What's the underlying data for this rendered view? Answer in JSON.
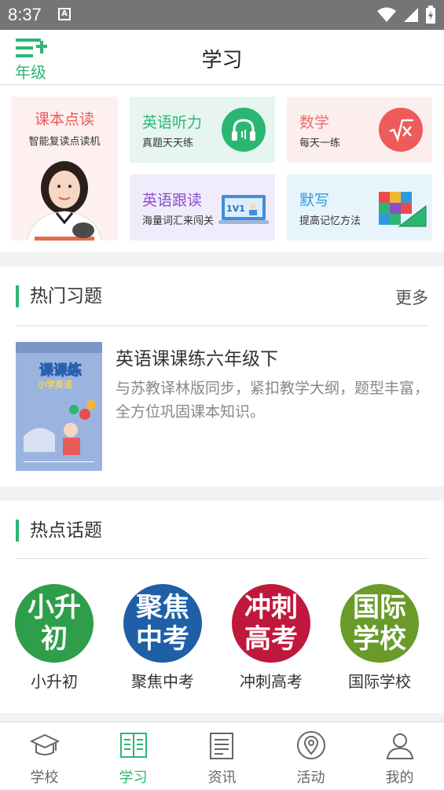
{
  "status_bar": {
    "time": "8:37",
    "notification_letter": "A"
  },
  "header": {
    "grade_label": "年级",
    "title": "学习"
  },
  "features": [
    {
      "title": "课本点读",
      "subtitle": "智能复读点读机"
    },
    {
      "title": "英语听力",
      "subtitle": "真题天天练",
      "icon": "headphones-icon"
    },
    {
      "title": "数学",
      "subtitle": "每天一练",
      "icon": "sqrt-icon"
    },
    {
      "title": "英语跟读",
      "subtitle": "海量词汇来闯关",
      "icon": "1v1-icon",
      "icon_text": "1V1"
    },
    {
      "title": "默写",
      "subtitle": "提高记忆方法",
      "icon": "number-blocks-icon"
    }
  ],
  "hot_exercises": {
    "title": "热门习题",
    "more": "更多",
    "book": {
      "title": "英语课课练六年级下",
      "description": "与苏教译林版同步，紧扣教学大纲，题型丰富，全方位巩固课本知识。",
      "cover_title": "课课练",
      "cover_subtitle": "小学英语"
    }
  },
  "hot_topics": {
    "title": "热点话题",
    "items": [
      {
        "circle_text": "小升初",
        "label": "小升初",
        "color": "#2e9e4a"
      },
      {
        "circle_text": "聚焦中考",
        "label": "聚焦中考",
        "color": "#1e5fa8"
      },
      {
        "circle_text": "冲刺高考",
        "label": "冲刺高考",
        "color": "#c0183c"
      },
      {
        "circle_text": "国际学校",
        "label": "国际学校",
        "color": "#6a9a2a"
      }
    ]
  },
  "tabs": [
    {
      "label": "学校",
      "icon": "school-hat-icon"
    },
    {
      "label": "学习",
      "icon": "book-icon",
      "active": true
    },
    {
      "label": "资讯",
      "icon": "news-icon"
    },
    {
      "label": "活动",
      "icon": "location-icon"
    },
    {
      "label": "我的",
      "icon": "profile-icon"
    }
  ],
  "colors": {
    "accent": "#2bb673"
  }
}
